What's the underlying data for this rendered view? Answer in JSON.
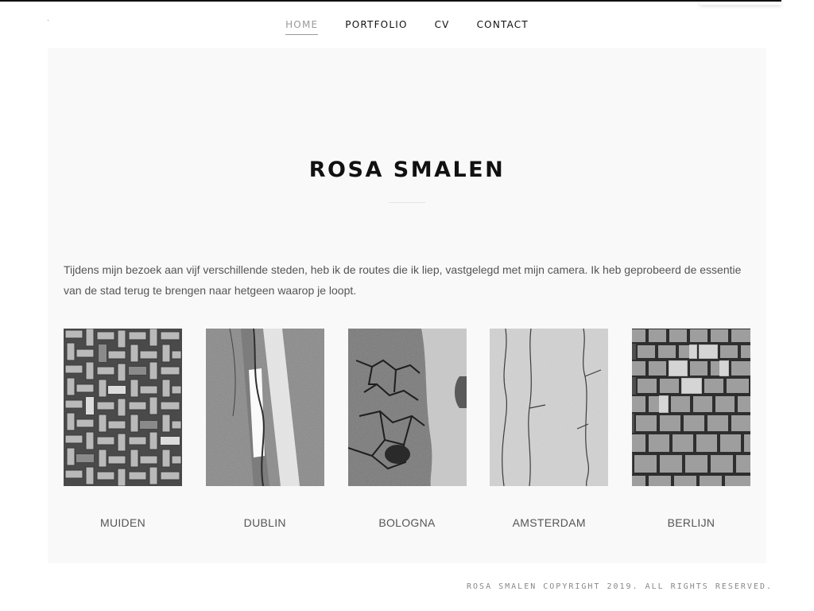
{
  "nav": {
    "items": [
      {
        "label": "HOME",
        "active": true
      },
      {
        "label": "PORTFOLIO",
        "active": false
      },
      {
        "label": "CV",
        "active": false
      },
      {
        "label": "CONTACT",
        "active": false
      }
    ]
  },
  "hero": {
    "title": "ROSA SMALEN"
  },
  "intro": {
    "text": "Tijdens mijn bezoek aan vijf verschillende steden, heb ik de routes die ik liep, vastgelegd met mijn camera. Ik heb geprobeerd de essentie van de stad terug te brengen naar hetgeen waarop je loopt."
  },
  "gallery": {
    "items": [
      {
        "city": "MUIDEN",
        "image": "brick-herringbone-pavement-photo"
      },
      {
        "city": "DUBLIN",
        "image": "asphalt-white-line-photo"
      },
      {
        "city": "BOLOGNA",
        "image": "cracked-asphalt-photo"
      },
      {
        "city": "AMSTERDAM",
        "image": "cracked-concrete-photo"
      },
      {
        "city": "BERLIJN",
        "image": "cobblestone-pavement-photo"
      }
    ]
  },
  "footer": {
    "text": "ROSA SMALEN COPYRIGHT 2019. ALL RIGHTS RESERVED."
  },
  "colors": {
    "text_dark": "#111111",
    "nav_active": "#9a9a9a",
    "panel_bg": "#f9f9f9",
    "body_text": "#555555",
    "footer_text": "#888888"
  }
}
